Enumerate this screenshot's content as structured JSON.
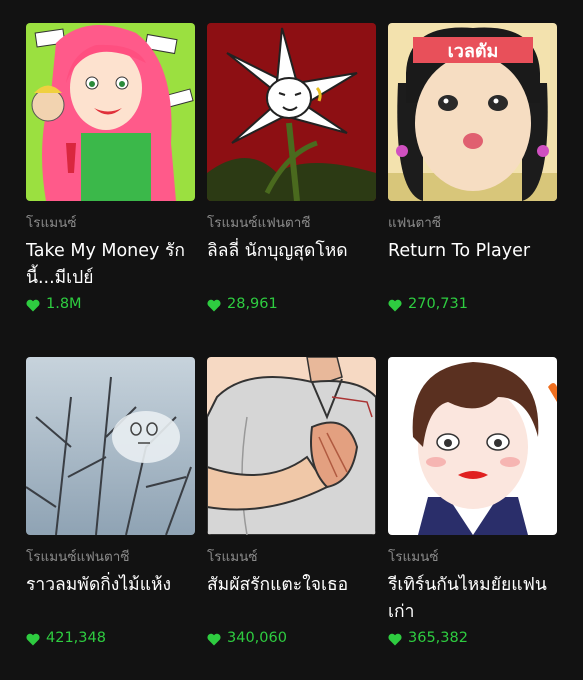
{
  "accent_color": "#2ecc40",
  "cards": [
    {
      "genre": "โรแมนซ์",
      "title": "Take My Money รักนี้...มีเปย์",
      "likes": "1.8M",
      "icon": "heart-icon"
    },
    {
      "genre": "โรแมนซ์แฟนตาซี",
      "title": "ลิลลี่ นักบุญสุดโหด",
      "likes": "28,961",
      "icon": "heart-icon"
    },
    {
      "genre": "แฟนตาซี",
      "title": "Return To Player",
      "likes": "270,731",
      "icon": "heart-icon",
      "cover_text": "เวลตัม"
    },
    {
      "genre": "โรแมนซ์แฟนตาซี",
      "title": "ราวลมพัดกิ่งไม้แห้ง",
      "likes": "421,348",
      "icon": "heart-icon"
    },
    {
      "genre": "โรแมนซ์",
      "title": "สัมผัสรักแตะใจเธอ",
      "likes": "340,060",
      "icon": "heart-icon"
    },
    {
      "genre": "โรแมนซ์",
      "title": "รีเทิร์นกันไหมยัยแฟนเก่า",
      "likes": "365,382",
      "icon": "heart-icon"
    }
  ]
}
